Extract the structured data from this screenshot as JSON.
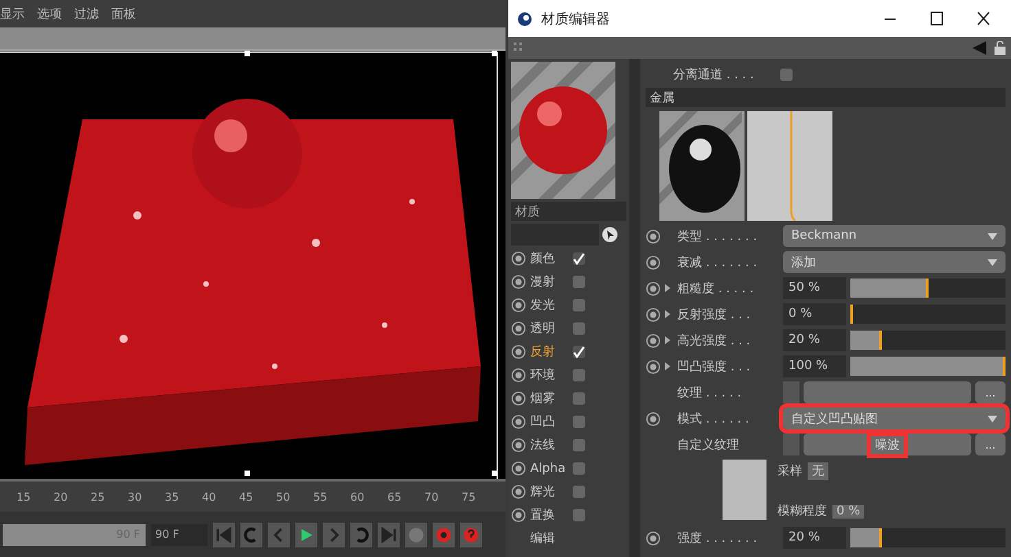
{
  "viewport": {
    "menu": [
      "显示",
      "选项",
      "过滤",
      "面板"
    ],
    "timeline": {
      "ticks": [
        "15",
        "20",
        "25",
        "30",
        "35",
        "40",
        "45",
        "50",
        "55",
        "60",
        "65",
        "70",
        "75"
      ],
      "end_frame": "90 F",
      "current_frame": "90 F"
    }
  },
  "editor": {
    "title": "材质编辑器",
    "material_name": "材质",
    "channels": [
      {
        "label": "颜色",
        "checked": true,
        "selected": false
      },
      {
        "label": "漫射",
        "checked": false,
        "selected": false
      },
      {
        "label": "发光",
        "checked": false,
        "selected": false
      },
      {
        "label": "透明",
        "checked": false,
        "selected": false
      },
      {
        "label": "反射",
        "checked": true,
        "selected": true
      },
      {
        "label": "环境",
        "checked": false,
        "selected": false
      },
      {
        "label": "烟雾",
        "checked": false,
        "selected": false
      },
      {
        "label": "凹凸",
        "checked": false,
        "selected": false
      },
      {
        "label": "法线",
        "checked": false,
        "selected": false
      },
      {
        "label": "Alpha",
        "checked": false,
        "selected": false
      },
      {
        "label": "辉光",
        "checked": false,
        "selected": false
      },
      {
        "label": "置换",
        "checked": false,
        "selected": false
      },
      {
        "label": "编辑",
        "kind": "plain"
      }
    ],
    "separate_pass": {
      "label": "分离通道 . . . .",
      "checked": false
    },
    "section": "金属",
    "params": [
      {
        "kind": "dropdown",
        "label": "类型 . . . . . . .",
        "value": "Beckmann",
        "highlighted": false
      },
      {
        "kind": "dropdown",
        "label": "衰减 . . . . . . .",
        "value": "添加",
        "highlighted": false
      },
      {
        "kind": "slider",
        "label": "粗糙度 . . . . .",
        "value": "50 %",
        "level": 0.5,
        "expandable": true
      },
      {
        "kind": "slider",
        "label": "反射强度 . . .",
        "value": "0 %",
        "level": 0,
        "expandable": true
      },
      {
        "kind": "slider",
        "label": "高光强度 . . .",
        "value": "20 %",
        "level": 0.2,
        "expandable": true
      },
      {
        "kind": "slider",
        "label": "凹凸强度 . . .",
        "value": "100 %",
        "level": 1,
        "expandable": true
      },
      {
        "kind": "texture",
        "label": "纹理 . . . . .",
        "highlighted": false,
        "browse_label": "..."
      },
      {
        "kind": "dropdown",
        "label": "模式 . . . . . .",
        "value": "自定义凹凸贴图",
        "highlighted": true
      },
      {
        "kind": "texture",
        "label": "自定义纹理",
        "value": "噪波",
        "highlighted": true,
        "browse_label": "..."
      },
      {
        "kind": "sample",
        "sampling_label": "采样",
        "sampling_value": "无",
        "blur_label": "模糊程度",
        "blur_value": "0 %"
      },
      {
        "kind": "slider",
        "label": "强度 . . . . . . .",
        "value": "20 %",
        "level": 0.2,
        "expandable": false
      }
    ]
  }
}
